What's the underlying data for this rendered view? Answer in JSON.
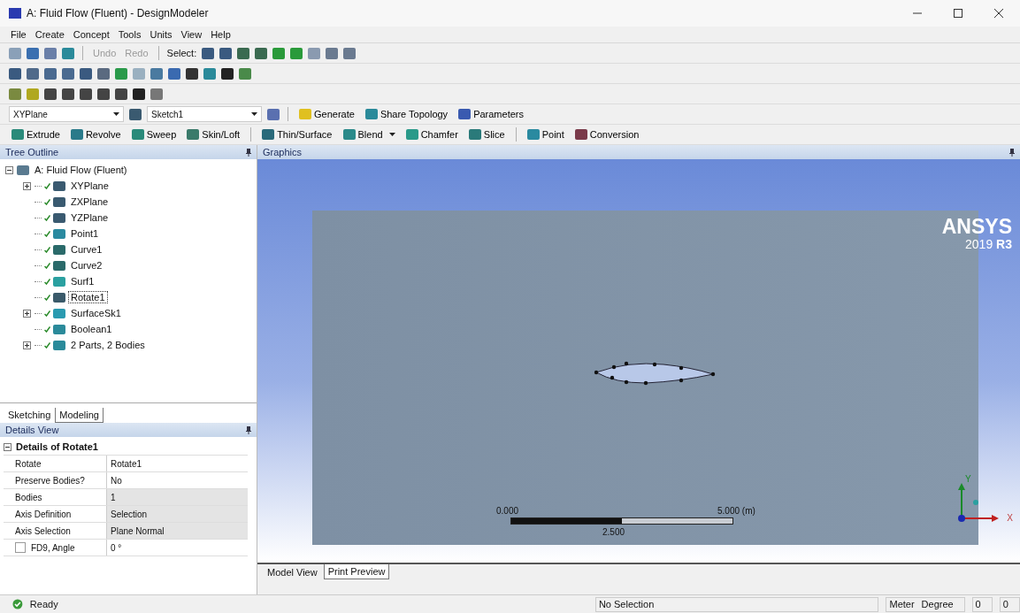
{
  "window": {
    "title": "A: Fluid Flow (Fluent) - DesignModeler"
  },
  "menu": [
    "File",
    "Create",
    "Concept",
    "Tools",
    "Units",
    "View",
    "Help"
  ],
  "toolbar": {
    "undo": {
      "label": "Undo",
      "disabled": true
    },
    "redo": {
      "label": "Redo",
      "disabled": true
    },
    "select_label": "Select:"
  },
  "sketch_bar": {
    "plane": "XYPlane",
    "sketch": "Sketch1",
    "buttons": [
      {
        "label": "Generate",
        "kind": "generate"
      },
      {
        "label": "Share Topology",
        "kind": "share"
      },
      {
        "label": "Parameters",
        "kind": "parameters"
      }
    ]
  },
  "feature_bar": [
    {
      "label": "Extrude",
      "kind": "extrude",
      "dropdown": false,
      "separator_before": false
    },
    {
      "label": "Revolve",
      "kind": "revolve",
      "dropdown": false,
      "separator_before": false
    },
    {
      "label": "Sweep",
      "kind": "sweep",
      "dropdown": false,
      "separator_before": false
    },
    {
      "label": "Skin/Loft",
      "kind": "skin",
      "dropdown": false,
      "separator_before": false
    },
    {
      "label": "Thin/Surface",
      "kind": "thin",
      "dropdown": false,
      "separator_before": true
    },
    {
      "label": "Blend",
      "kind": "blend",
      "dropdown": true,
      "separator_before": false
    },
    {
      "label": "Chamfer",
      "kind": "chamfer",
      "dropdown": false,
      "separator_before": false
    },
    {
      "label": "Slice",
      "kind": "slice",
      "dropdown": false,
      "separator_before": false
    },
    {
      "label": "Point",
      "kind": "point",
      "dropdown": false,
      "separator_before": true
    },
    {
      "label": "Conversion",
      "kind": "conversion",
      "dropdown": false,
      "separator_before": false
    }
  ],
  "tree_outline": {
    "title": "Tree Outline",
    "root": {
      "label": "A: Fluid Flow (Fluent)",
      "kind": "model",
      "expanded": true,
      "selected": false,
      "children": [
        {
          "label": "XYPlane",
          "kind": "plane",
          "expanded": false,
          "selected": false
        },
        {
          "label": "ZXPlane",
          "kind": "plane",
          "selected": false
        },
        {
          "label": "YZPlane",
          "kind": "plane",
          "selected": false
        },
        {
          "label": "Point1",
          "kind": "point",
          "selected": false
        },
        {
          "label": "Curve1",
          "kind": "curve",
          "selected": false
        },
        {
          "label": "Curve2",
          "kind": "curve",
          "selected": false
        },
        {
          "label": "Surf1",
          "kind": "surface",
          "selected": false
        },
        {
          "label": "Rotate1",
          "kind": "rotate",
          "selected": true
        },
        {
          "label": "SurfaceSk1",
          "kind": "surfacesk",
          "expanded": false,
          "selected": false
        },
        {
          "label": "Boolean1",
          "kind": "boolean",
          "selected": false
        },
        {
          "label": "2 Parts, 2 Bodies",
          "kind": "parts",
          "expanded": false,
          "selected": false
        }
      ]
    }
  },
  "mode_tabs": [
    {
      "label": "Sketching",
      "selected": false
    },
    {
      "label": "Modeling",
      "selected": true
    }
  ],
  "details_view": {
    "title": "Details View",
    "section": "Details of Rotate1",
    "expanded": true,
    "rows": [
      {
        "label": "Rotate",
        "value": "Rotate1",
        "readonly": false
      },
      {
        "label": "Preserve Bodies?",
        "value": "No",
        "readonly": false
      },
      {
        "label": "Bodies",
        "value": "1",
        "readonly": true
      },
      {
        "label": "Axis Definition",
        "value": "Selection",
        "readonly": true
      },
      {
        "label": "Axis Selection",
        "value": "Plane Normal",
        "readonly": true
      },
      {
        "label": "FD9, Angle",
        "value": "0 °",
        "readonly": false,
        "parameter": false
      }
    ]
  },
  "graphics": {
    "title": "Graphics",
    "logo": "ANSYS",
    "version": "2019",
    "release": "R3",
    "scale": {
      "start": "0.000",
      "end": "5.000 (m)",
      "mid": "2.500"
    },
    "axes": {
      "x": "X",
      "y": "Y"
    }
  },
  "view_tabs": [
    {
      "label": "Model View",
      "selected": false
    },
    {
      "label": "Print Preview",
      "selected": true
    }
  ],
  "status_bar": {
    "state": "Ready",
    "selection": "No Selection",
    "length_unit": "Meter",
    "angle_unit": "Degree",
    "field_1": "0",
    "field_2": "0"
  }
}
